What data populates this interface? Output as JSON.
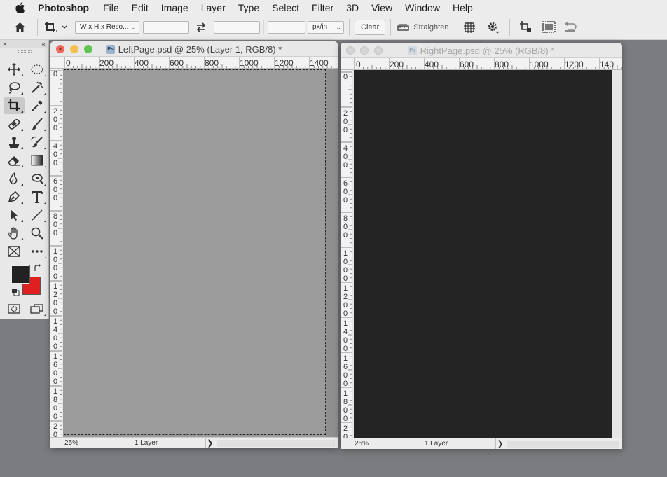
{
  "menubar": {
    "app_name": "Photoshop",
    "items": [
      "File",
      "Edit",
      "Image",
      "Layer",
      "Type",
      "Select",
      "Filter",
      "3D",
      "View",
      "Window",
      "Help"
    ]
  },
  "options": {
    "ratio_label": "W x H x Reso...",
    "width_value": "",
    "height_value": "",
    "resolution_value": "",
    "units_label": "px/in",
    "clear_label": "Clear",
    "straighten_label": "Straighten"
  },
  "tools_panel": {
    "close_glyph": "×",
    "collapse_glyph": "«"
  },
  "left_doc": {
    "title": "LeftPage.psd @ 25% (Layer 1, RGB/8) *",
    "ruler_h_labels": [
      "0",
      "200",
      "400",
      "600",
      "800",
      "1000",
      "1200",
      "1400"
    ],
    "ruler_v_labels": [
      "0",
      "200",
      "400",
      "600",
      "800",
      "1000",
      "1200",
      "1400",
      "1600",
      "1800",
      "20"
    ],
    "zoom": "25%",
    "status": "1 Layer",
    "canvas_color": "#9b9b9b"
  },
  "right_doc": {
    "title": "RightPage.psd @ 25% (RGB/8) *",
    "ruler_h_labels": [
      "0",
      "200",
      "400",
      "600",
      "800",
      "1000",
      "1200",
      "140"
    ],
    "ruler_v_labels": [
      "0",
      "200",
      "400",
      "600",
      "800",
      "1000",
      "1200",
      "1400",
      "1600",
      "1800",
      "20"
    ],
    "zoom": "25%",
    "status": "1 Layer",
    "canvas_color": "#242424"
  },
  "colors": {
    "foreground": "#222222",
    "background": "#e02020",
    "close_red": "#ed6a5e",
    "minimize_yellow": "#f5bf4f",
    "zoom_green": "#61c554"
  },
  "status_arrow": "❯"
}
